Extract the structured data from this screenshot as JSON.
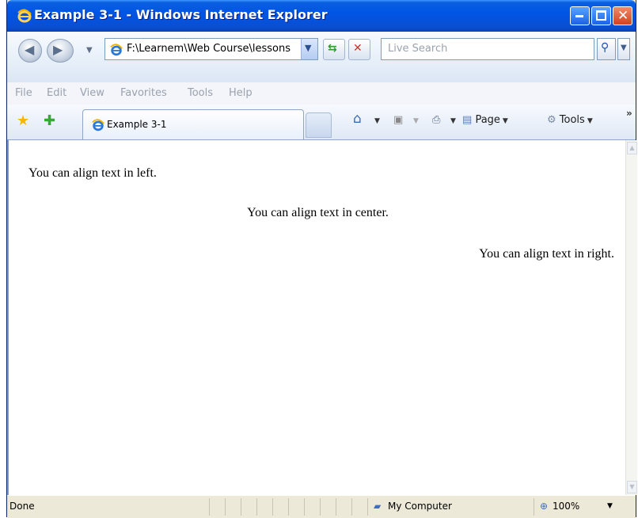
{
  "window": {
    "title": "Example 3-1 - Windows Internet Explorer",
    "buttons": {
      "minimize": "minimize-icon",
      "maximize": "maximize-icon",
      "close": "close-icon"
    }
  },
  "address_bar": {
    "url": "F:\\Learnem\\Web Course\\lessons",
    "search_placeholder": "Live Search"
  },
  "menu": [
    "File",
    "Edit",
    "View",
    "Favorites",
    "Tools",
    "Help"
  ],
  "tab": {
    "title": "Example 3-1"
  },
  "command_bar": {
    "page_label": "Page",
    "tools_label": "Tools"
  },
  "page_content": {
    "left_text": "You can align text in left.",
    "center_text": "You can align text in center.",
    "right_text": "You can align text in right."
  },
  "status_bar": {
    "status": "Done",
    "zone": "My Computer",
    "zoom": "100%"
  },
  "colors": {
    "titlebar": "#0055e5",
    "close_button": "#d2431c"
  }
}
